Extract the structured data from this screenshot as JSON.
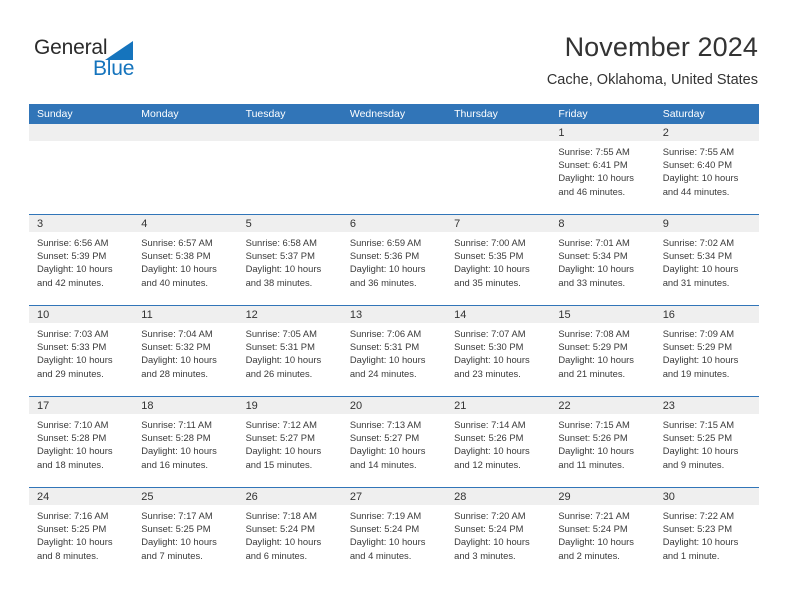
{
  "branding": {
    "logo_text_primary": "General",
    "logo_text_secondary": "Blue",
    "logo_accent_color": "#1574bd"
  },
  "header": {
    "title": "November 2024",
    "subtitle": "Cache, Oklahoma, United States"
  },
  "theme": {
    "header_blue": "#3175b8",
    "daynum_band": "#efefef",
    "text": "#333333"
  },
  "weekdays": [
    "Sunday",
    "Monday",
    "Tuesday",
    "Wednesday",
    "Thursday",
    "Friday",
    "Saturday"
  ],
  "weeks": [
    [
      {
        "day": "",
        "sunrise": "",
        "sunset": "",
        "daylight": "",
        "empty": true
      },
      {
        "day": "",
        "sunrise": "",
        "sunset": "",
        "daylight": "",
        "empty": true
      },
      {
        "day": "",
        "sunrise": "",
        "sunset": "",
        "daylight": "",
        "empty": true
      },
      {
        "day": "",
        "sunrise": "",
        "sunset": "",
        "daylight": "",
        "empty": true
      },
      {
        "day": "",
        "sunrise": "",
        "sunset": "",
        "daylight": "",
        "empty": true
      },
      {
        "day": "1",
        "sunrise": "Sunrise: 7:55 AM",
        "sunset": "Sunset: 6:41 PM",
        "daylight": "Daylight: 10 hours and 46 minutes."
      },
      {
        "day": "2",
        "sunrise": "Sunrise: 7:55 AM",
        "sunset": "Sunset: 6:40 PM",
        "daylight": "Daylight: 10 hours and 44 minutes."
      }
    ],
    [
      {
        "day": "3",
        "sunrise": "Sunrise: 6:56 AM",
        "sunset": "Sunset: 5:39 PM",
        "daylight": "Daylight: 10 hours and 42 minutes."
      },
      {
        "day": "4",
        "sunrise": "Sunrise: 6:57 AM",
        "sunset": "Sunset: 5:38 PM",
        "daylight": "Daylight: 10 hours and 40 minutes."
      },
      {
        "day": "5",
        "sunrise": "Sunrise: 6:58 AM",
        "sunset": "Sunset: 5:37 PM",
        "daylight": "Daylight: 10 hours and 38 minutes."
      },
      {
        "day": "6",
        "sunrise": "Sunrise: 6:59 AM",
        "sunset": "Sunset: 5:36 PM",
        "daylight": "Daylight: 10 hours and 36 minutes."
      },
      {
        "day": "7",
        "sunrise": "Sunrise: 7:00 AM",
        "sunset": "Sunset: 5:35 PM",
        "daylight": "Daylight: 10 hours and 35 minutes."
      },
      {
        "day": "8",
        "sunrise": "Sunrise: 7:01 AM",
        "sunset": "Sunset: 5:34 PM",
        "daylight": "Daylight: 10 hours and 33 minutes."
      },
      {
        "day": "9",
        "sunrise": "Sunrise: 7:02 AM",
        "sunset": "Sunset: 5:34 PM",
        "daylight": "Daylight: 10 hours and 31 minutes."
      }
    ],
    [
      {
        "day": "10",
        "sunrise": "Sunrise: 7:03 AM",
        "sunset": "Sunset: 5:33 PM",
        "daylight": "Daylight: 10 hours and 29 minutes."
      },
      {
        "day": "11",
        "sunrise": "Sunrise: 7:04 AM",
        "sunset": "Sunset: 5:32 PM",
        "daylight": "Daylight: 10 hours and 28 minutes."
      },
      {
        "day": "12",
        "sunrise": "Sunrise: 7:05 AM",
        "sunset": "Sunset: 5:31 PM",
        "daylight": "Daylight: 10 hours and 26 minutes."
      },
      {
        "day": "13",
        "sunrise": "Sunrise: 7:06 AM",
        "sunset": "Sunset: 5:31 PM",
        "daylight": "Daylight: 10 hours and 24 minutes."
      },
      {
        "day": "14",
        "sunrise": "Sunrise: 7:07 AM",
        "sunset": "Sunset: 5:30 PM",
        "daylight": "Daylight: 10 hours and 23 minutes."
      },
      {
        "day": "15",
        "sunrise": "Sunrise: 7:08 AM",
        "sunset": "Sunset: 5:29 PM",
        "daylight": "Daylight: 10 hours and 21 minutes."
      },
      {
        "day": "16",
        "sunrise": "Sunrise: 7:09 AM",
        "sunset": "Sunset: 5:29 PM",
        "daylight": "Daylight: 10 hours and 19 minutes."
      }
    ],
    [
      {
        "day": "17",
        "sunrise": "Sunrise: 7:10 AM",
        "sunset": "Sunset: 5:28 PM",
        "daylight": "Daylight: 10 hours and 18 minutes."
      },
      {
        "day": "18",
        "sunrise": "Sunrise: 7:11 AM",
        "sunset": "Sunset: 5:28 PM",
        "daylight": "Daylight: 10 hours and 16 minutes."
      },
      {
        "day": "19",
        "sunrise": "Sunrise: 7:12 AM",
        "sunset": "Sunset: 5:27 PM",
        "daylight": "Daylight: 10 hours and 15 minutes."
      },
      {
        "day": "20",
        "sunrise": "Sunrise: 7:13 AM",
        "sunset": "Sunset: 5:27 PM",
        "daylight": "Daylight: 10 hours and 14 minutes."
      },
      {
        "day": "21",
        "sunrise": "Sunrise: 7:14 AM",
        "sunset": "Sunset: 5:26 PM",
        "daylight": "Daylight: 10 hours and 12 minutes."
      },
      {
        "day": "22",
        "sunrise": "Sunrise: 7:15 AM",
        "sunset": "Sunset: 5:26 PM",
        "daylight": "Daylight: 10 hours and 11 minutes."
      },
      {
        "day": "23",
        "sunrise": "Sunrise: 7:15 AM",
        "sunset": "Sunset: 5:25 PM",
        "daylight": "Daylight: 10 hours and 9 minutes."
      }
    ],
    [
      {
        "day": "24",
        "sunrise": "Sunrise: 7:16 AM",
        "sunset": "Sunset: 5:25 PM",
        "daylight": "Daylight: 10 hours and 8 minutes."
      },
      {
        "day": "25",
        "sunrise": "Sunrise: 7:17 AM",
        "sunset": "Sunset: 5:25 PM",
        "daylight": "Daylight: 10 hours and 7 minutes."
      },
      {
        "day": "26",
        "sunrise": "Sunrise: 7:18 AM",
        "sunset": "Sunset: 5:24 PM",
        "daylight": "Daylight: 10 hours and 6 minutes."
      },
      {
        "day": "27",
        "sunrise": "Sunrise: 7:19 AM",
        "sunset": "Sunset: 5:24 PM",
        "daylight": "Daylight: 10 hours and 4 minutes."
      },
      {
        "day": "28",
        "sunrise": "Sunrise: 7:20 AM",
        "sunset": "Sunset: 5:24 PM",
        "daylight": "Daylight: 10 hours and 3 minutes."
      },
      {
        "day": "29",
        "sunrise": "Sunrise: 7:21 AM",
        "sunset": "Sunset: 5:24 PM",
        "daylight": "Daylight: 10 hours and 2 minutes."
      },
      {
        "day": "30",
        "sunrise": "Sunrise: 7:22 AM",
        "sunset": "Sunset: 5:23 PM",
        "daylight": "Daylight: 10 hours and 1 minute."
      }
    ]
  ]
}
